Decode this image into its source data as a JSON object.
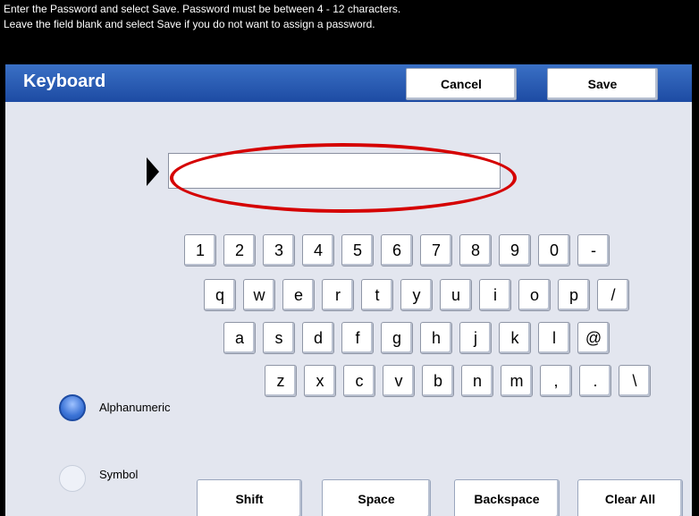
{
  "instructions": {
    "line1": "Enter the Password and select Save.  Password must be between 4 - 12 characters.",
    "line2": "Leave the field blank and select Save if you do not want to assign a password."
  },
  "header": {
    "title": "Keyboard",
    "cancel_label": "Cancel",
    "save_label": "Save"
  },
  "password_field": {
    "value": ""
  },
  "keyboard": {
    "row1": [
      "1",
      "2",
      "3",
      "4",
      "5",
      "6",
      "7",
      "8",
      "9",
      "0",
      "-"
    ],
    "row2": [
      "q",
      "w",
      "e",
      "r",
      "t",
      "y",
      "u",
      "i",
      "o",
      "p",
      "/"
    ],
    "row3": [
      "a",
      "s",
      "d",
      "f",
      "g",
      "h",
      "j",
      "k",
      "l",
      "@"
    ],
    "row4": [
      "z",
      "x",
      "c",
      "v",
      "b",
      "n",
      "m",
      ",",
      ".",
      "\\"
    ]
  },
  "modes": {
    "alphanumeric": "Alphanumeric",
    "symbol": "Symbol",
    "selected": "Alphanumeric"
  },
  "bottom_buttons": {
    "shift": "Shift",
    "space": "Space",
    "backspace": "Backspace",
    "clear_all": "Clear All"
  },
  "colors": {
    "header_blue": "#1d4ba3",
    "highlight_red": "#d50000",
    "background": "#e3e6ef"
  }
}
